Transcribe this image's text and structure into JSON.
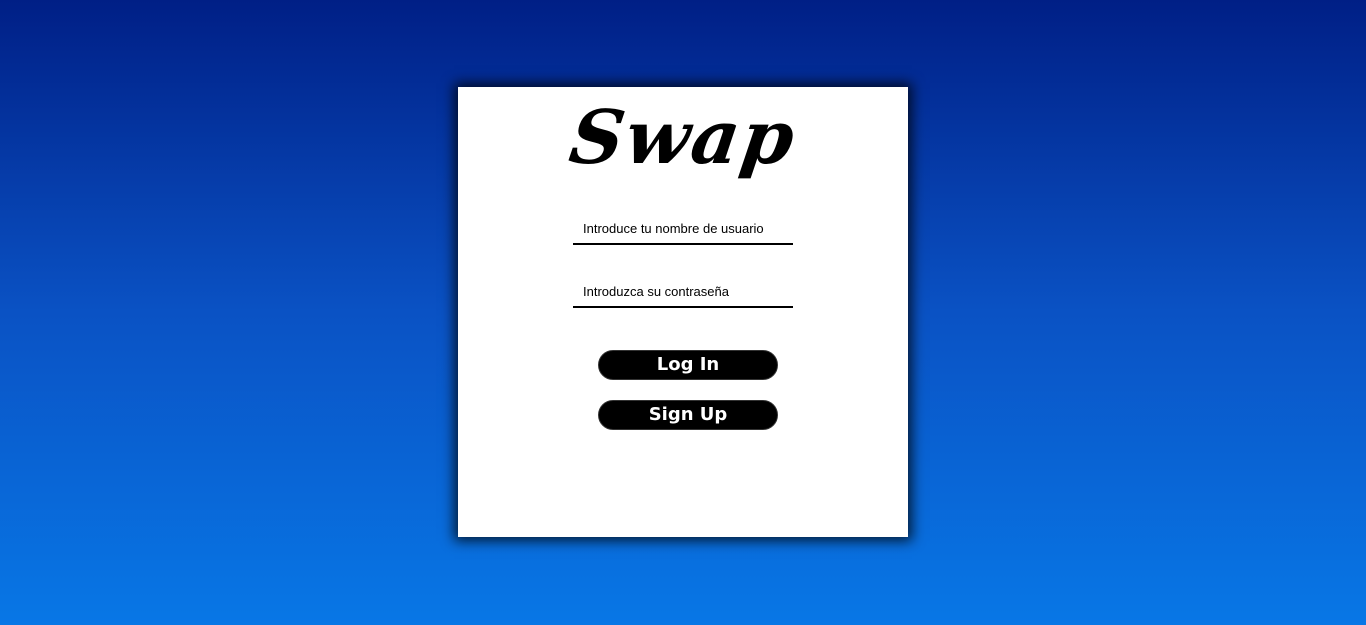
{
  "login_card": {
    "logo_text": "Swap",
    "username": {
      "placeholder": "Introduce tu nombre de usuario",
      "value": ""
    },
    "password": {
      "placeholder": "Introduzca su contraseña",
      "value": ""
    },
    "login_label": "Log In",
    "signup_label": "Sign Up"
  },
  "colors": {
    "background_top": "#001f86",
    "background_bottom": "#0877e6",
    "card": "#ffffff",
    "button": "#000000",
    "button_text": "#ffffff"
  }
}
